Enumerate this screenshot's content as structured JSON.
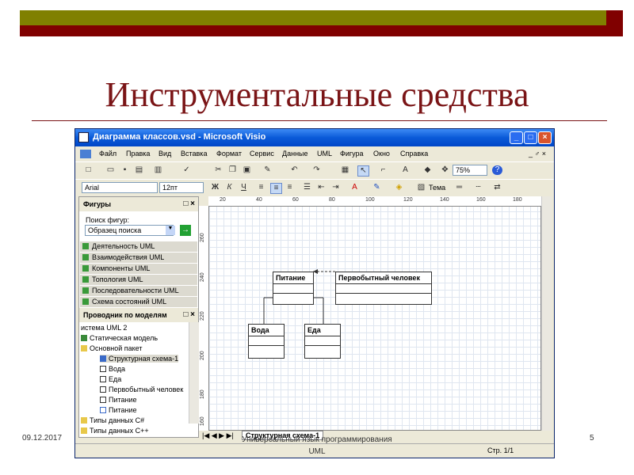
{
  "slide": {
    "title": "Инструментальные средства",
    "date": "09.12.2017",
    "footer_line1": "Универсальный  язык программирования",
    "footer_line2": "UML",
    "page_number": "5"
  },
  "colors": {
    "title": "#7a1416",
    "olive": "#808000",
    "maroon": "#800000"
  },
  "window": {
    "title": "Диаграмма классов.vsd - Microsoft Visio",
    "buttons": {
      "minimize": "_",
      "maximize": "□",
      "close": "×"
    },
    "menu": [
      "Файл",
      "Правка",
      "Вид",
      "Вставка",
      "Формат",
      "Сервис",
      "Данные",
      "UML",
      "Фигура",
      "Окно",
      "Справка"
    ],
    "menu_right": "_ ♂ ×",
    "toolbar": {
      "zoom": "75%",
      "font": "Arial",
      "size": "12пт",
      "theme_label": "Тема"
    },
    "shapes_pane": {
      "title": "Фигуры",
      "search_label": "Поиск фигур:",
      "search_placeholder": "Образец поиска",
      "stencils": [
        "Деятельность UML",
        "Взаимодействия UML",
        "Компоненты UML",
        "Топология UML",
        "Последовательности UML",
        "Схема состояний UML"
      ]
    },
    "model_explorer": {
      "title": "Проводник по моделям",
      "items": [
        "истема UML 2",
        "Статическая модель",
        "Основной пакет",
        "Структурная схема-1",
        "Вода",
        "Еда",
        "Первобытный человек",
        "Питание",
        "Питание",
        "Типы данных C#",
        "Типы данных C++"
      ]
    },
    "ruler_h": [
      "20",
      "40",
      "60",
      "80",
      "100",
      "120",
      "140",
      "160",
      "180"
    ],
    "ruler_v": [
      "260",
      "240",
      "220",
      "200",
      "180",
      "160"
    ],
    "diagram": {
      "classes": [
        "Питание",
        "Первобытный человек",
        "Вода",
        "Еда"
      ]
    },
    "sheet_tab": "Структурная схема-1",
    "status": {
      "page": "Стр. 1/1"
    }
  }
}
